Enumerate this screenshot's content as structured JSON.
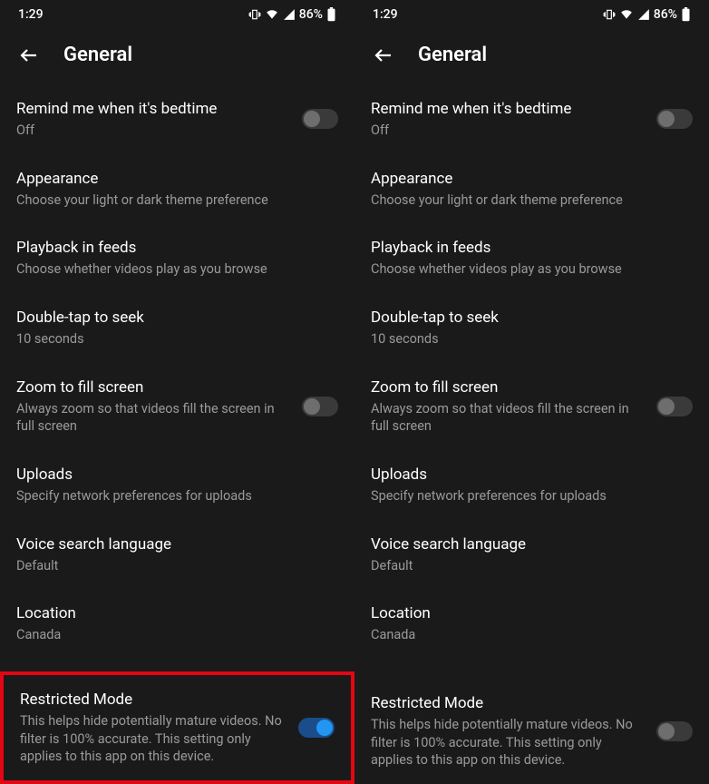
{
  "screens": [
    {
      "status": {
        "time": "1:29",
        "battery": "86%"
      },
      "header": {
        "title": "General"
      },
      "items": {
        "bedtime": {
          "title": "Remind me when it's bedtime",
          "sub": "Off",
          "toggle": "off"
        },
        "appearance": {
          "title": "Appearance",
          "sub": "Choose your light or dark theme preference"
        },
        "playback": {
          "title": "Playback in feeds",
          "sub": "Choose whether videos play as you browse"
        },
        "doubletap": {
          "title": "Double-tap to seek",
          "sub": "10 seconds"
        },
        "zoom": {
          "title": "Zoom to fill screen",
          "sub": "Always zoom so that videos fill the screen in full screen",
          "toggle": "off"
        },
        "uploads": {
          "title": "Uploads",
          "sub": "Specify network preferences for uploads"
        },
        "voice": {
          "title": "Voice search language",
          "sub": "Default"
        },
        "location": {
          "title": "Location",
          "sub": "Canada"
        },
        "restricted": {
          "title": "Restricted Mode",
          "sub": "This helps hide potentially mature videos. No filter is 100% accurate. This setting only applies to this app on this device.",
          "toggle": "on",
          "highlight": true
        }
      }
    },
    {
      "status": {
        "time": "1:29",
        "battery": "86%"
      },
      "header": {
        "title": "General"
      },
      "items": {
        "bedtime": {
          "title": "Remind me when it's bedtime",
          "sub": "Off",
          "toggle": "off"
        },
        "appearance": {
          "title": "Appearance",
          "sub": "Choose your light or dark theme preference"
        },
        "playback": {
          "title": "Playback in feeds",
          "sub": "Choose whether videos play as you browse"
        },
        "doubletap": {
          "title": "Double-tap to seek",
          "sub": "10 seconds"
        },
        "zoom": {
          "title": "Zoom to fill screen",
          "sub": "Always zoom so that videos fill the screen in full screen",
          "toggle": "off"
        },
        "uploads": {
          "title": "Uploads",
          "sub": "Specify network preferences for uploads"
        },
        "voice": {
          "title": "Voice search language",
          "sub": "Default"
        },
        "location": {
          "title": "Location",
          "sub": "Canada"
        },
        "restricted": {
          "title": "Restricted Mode",
          "sub": "This helps hide potentially mature videos. No filter is 100% accurate. This setting only applies to this app on this device.",
          "toggle": "off",
          "highlight": false
        }
      }
    }
  ]
}
